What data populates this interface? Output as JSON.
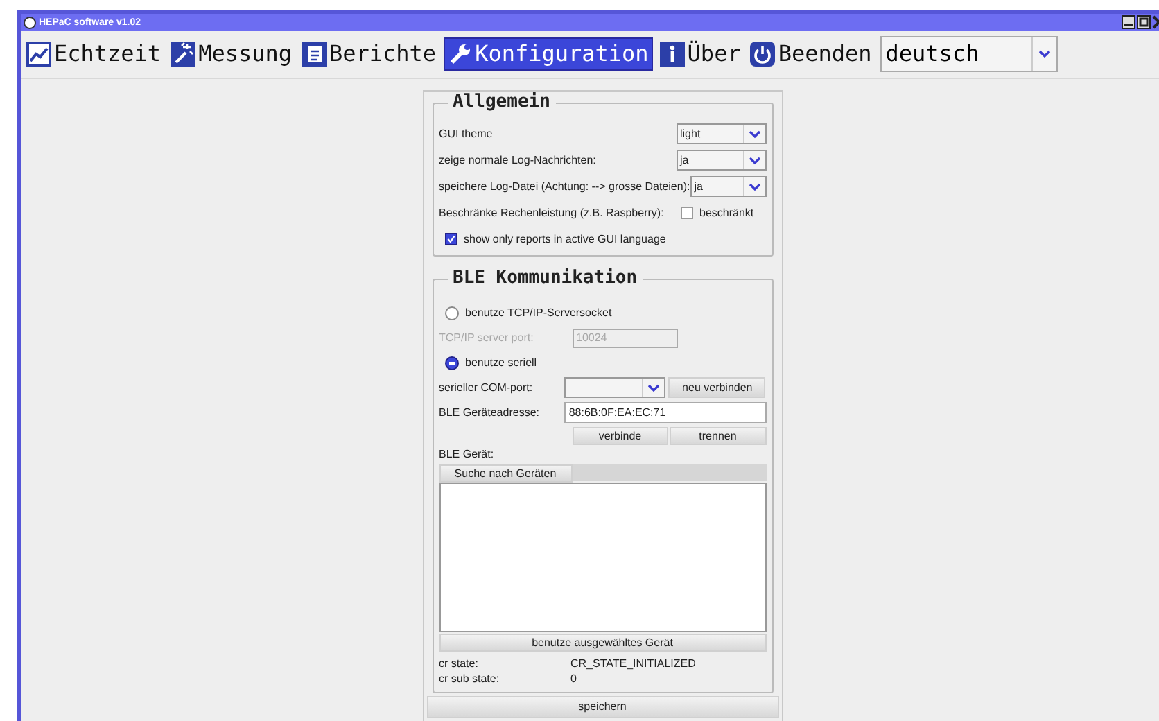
{
  "window": {
    "title": "HEPaC software v1.02"
  },
  "toolbar": [
    {
      "label": "Echtzeit",
      "kind": "chart",
      "selected": false
    },
    {
      "label": "Messung",
      "kind": "wand",
      "selected": false
    },
    {
      "label": "Berichte",
      "kind": "document",
      "selected": false
    },
    {
      "label": "Konfiguration",
      "kind": "wrench",
      "selected": true
    },
    {
      "label": "Über",
      "kind": "info",
      "selected": false
    },
    {
      "label": "Beenden",
      "kind": "power",
      "selected": false
    }
  ],
  "language": {
    "value": "deutsch"
  },
  "general": {
    "title": "Allgemein",
    "settings": [
      {
        "kind": "combo",
        "label": "GUI theme",
        "value": "light"
      },
      {
        "kind": "combo",
        "label": "zeige normale Log-Nachrichten:",
        "value": "ja"
      },
      {
        "kind": "combo",
        "label": "speichere Log-Datei (Achtung: --> grosse Dateien):",
        "value": "ja"
      },
      {
        "kind": "checkbox",
        "label": "Beschränke Rechenleistung (z.B. Raspberry):",
        "option": "beschränkt",
        "checked": false
      },
      {
        "kind": "checkbox",
        "option": "show only reports in active GUI language",
        "checked": true
      }
    ]
  },
  "ble": {
    "title": "BLE Kommunikation",
    "tcp_radio": {
      "label": "benutze TCP/IP-Serversocket",
      "selected": false
    },
    "tcp_port": {
      "label": "TCP/IP server port:",
      "value": "10024",
      "disabled": true
    },
    "serial_radio": {
      "label": "benutze seriell",
      "selected": true
    },
    "com_port": {
      "label": "serieller COM-port:",
      "button": "neu verbinden"
    },
    "address": {
      "label": "BLE Geräteadresse:",
      "value": "88:6B:0F:EA:EC:71"
    },
    "buttons": [
      "verbinde",
      "trennen"
    ],
    "device_label": "BLE Gerät:",
    "search_button": "Suche nach Geräten",
    "use_button": "benutze ausgewähltes Gerät",
    "status": [
      {
        "label": "cr state:",
        "value": "CR_STATE_INITIALIZED"
      },
      {
        "label": "cr sub state:",
        "value": "0"
      }
    ]
  },
  "save_button": "speichern"
}
